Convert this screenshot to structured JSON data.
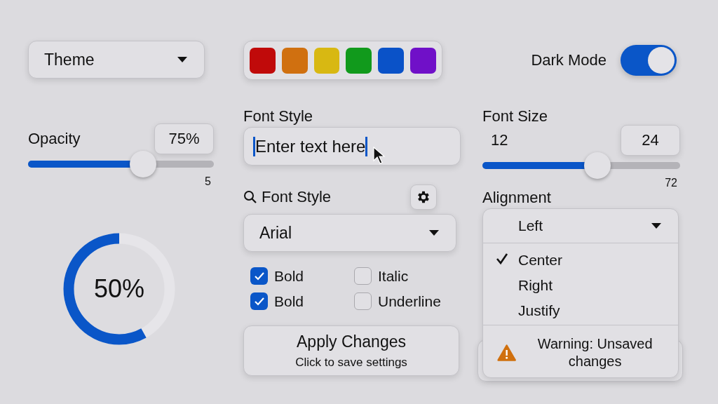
{
  "theme_select": {
    "value": "Theme"
  },
  "opacity": {
    "label": "Opacity",
    "value": "75%",
    "level": 0.62,
    "min_label": "5"
  },
  "progress_ring": {
    "label": "50%",
    "level": 0.58
  },
  "swatches": [
    {
      "color": "#c00a0a"
    },
    {
      "color": "#d07010"
    },
    {
      "color": "#d8b812"
    },
    {
      "color": "#119a1c"
    },
    {
      "color": "#0a52c8"
    },
    {
      "color": "#7010c8"
    }
  ],
  "font_style_input": {
    "label": "Font Style",
    "value": "Enter text here"
  },
  "font_family": {
    "label": "Font Style",
    "value": "Arial"
  },
  "checkboxes": [
    {
      "label": "Bold",
      "checked": true
    },
    {
      "label": "Italic",
      "checked": false
    },
    {
      "label": "Bold",
      "checked": true
    },
    {
      "label": "Underline",
      "checked": false
    }
  ],
  "apply_button": {
    "title": "Apply Changes",
    "subtitle": "Click to save settings"
  },
  "dark_mode": {
    "label": "Dark Mode",
    "on": true
  },
  "font_size": {
    "label": "Font Size",
    "min": "12",
    "value": "24",
    "level": 0.58,
    "max_label": "72"
  },
  "alignment": {
    "label": "Alignment",
    "value": "Left",
    "expanded": true,
    "options": [
      {
        "label": "Center",
        "selected": true
      },
      {
        "label": "Right",
        "selected": false
      },
      {
        "label": "Justify",
        "selected": false
      }
    ],
    "warning": "Warning: Unsaved changes"
  }
}
